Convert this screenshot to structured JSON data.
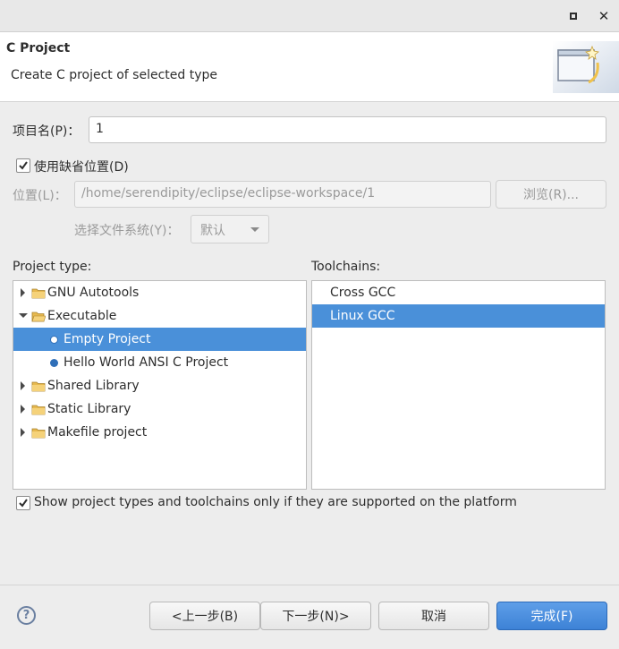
{
  "window": {
    "maximize_icon": "maximize-icon",
    "close_label": "✕"
  },
  "header": {
    "title": "C Project",
    "description": "Create C project of selected type",
    "banner_icon": "wizard-banner-icon"
  },
  "project_name": {
    "label": "项目名(P)：",
    "value": "1"
  },
  "use_default_location": {
    "label": "使用缺省位置(D)",
    "checked": true
  },
  "location": {
    "label": "位置(L)：",
    "value": "/home/serendipity/eclipse/eclipse-workspace/1",
    "browse_label": "浏览(R)..."
  },
  "file_system": {
    "label": "选择文件系统(Y)：",
    "selected": "默认"
  },
  "project_type": {
    "label": "Project type:",
    "items": [
      {
        "label": "GNU Autotools",
        "kind": "folder",
        "expanded": false
      },
      {
        "label": "Executable",
        "kind": "folder",
        "expanded": true
      },
      {
        "label": "Empty Project",
        "kind": "project",
        "selected": true
      },
      {
        "label": "Hello World ANSI C Project",
        "kind": "project",
        "selected": false
      },
      {
        "label": "Shared Library",
        "kind": "folder",
        "expanded": false
      },
      {
        "label": "Static Library",
        "kind": "folder",
        "expanded": false
      },
      {
        "label": "Makefile project",
        "kind": "folder",
        "expanded": false
      }
    ]
  },
  "toolchains": {
    "label": "Toolchains:",
    "items": [
      {
        "label": "Cross GCC",
        "selected": false
      },
      {
        "label": "Linux GCC",
        "selected": true
      }
    ]
  },
  "show_supported": {
    "label": "Show project types and toolchains only if they are supported on the platform",
    "checked": true
  },
  "footer": {
    "help_label": "?",
    "back_label": "<上一步(B)",
    "next_label": "下一步(N)>",
    "cancel_label": "取消",
    "finish_label": "完成(F)"
  },
  "colors": {
    "selection": "#4a90d9",
    "primary_button": "#3d82d6",
    "folder": "#e7b94f"
  }
}
